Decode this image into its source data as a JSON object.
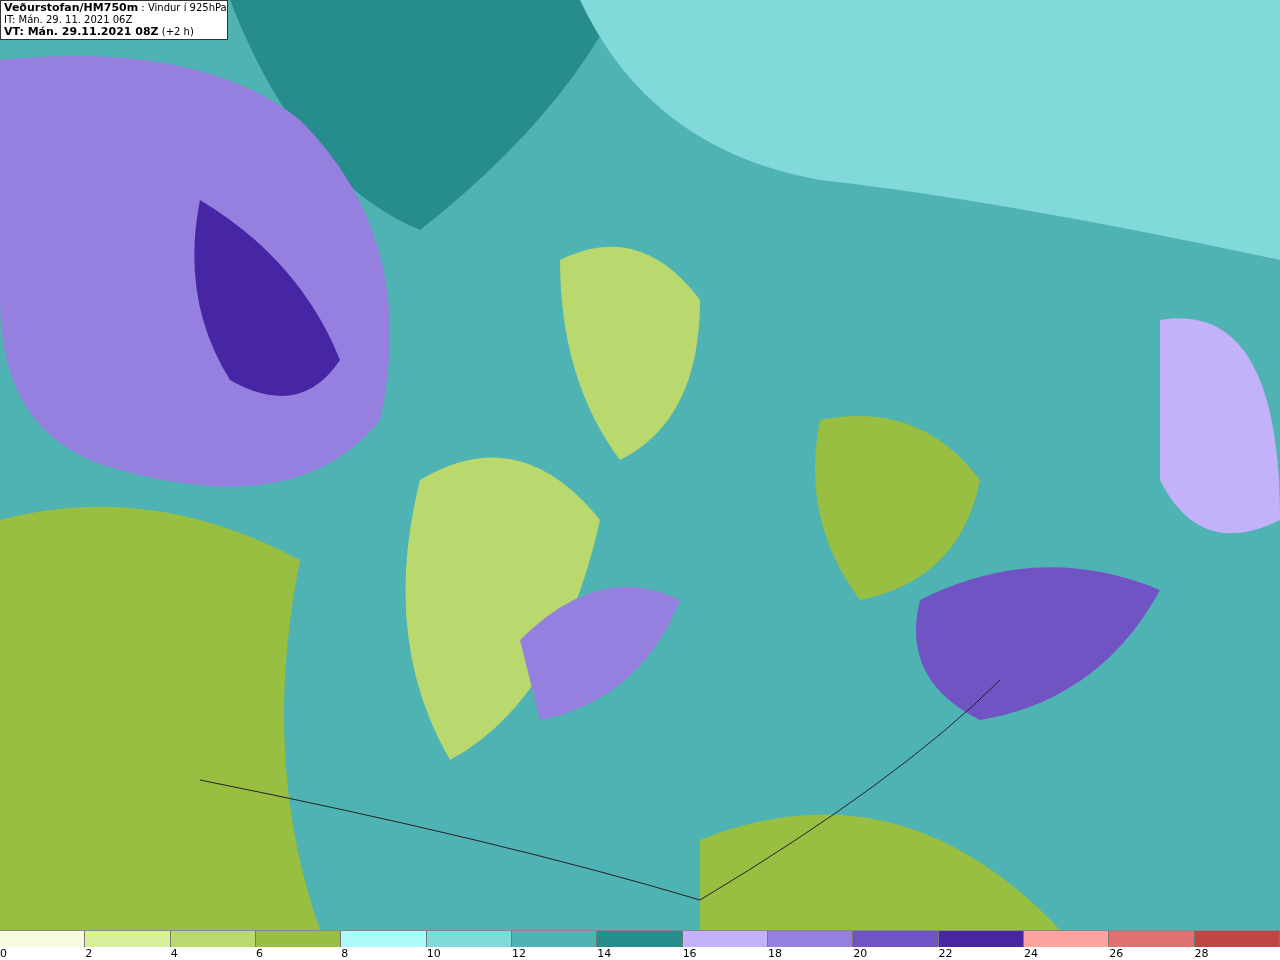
{
  "header": {
    "title": "**Veðurstofan/HM750m** : Vindur í 925hPa",
    "issue_time": "IT: Mán. 29. 11. 2021 06Z",
    "valid_time": "**VT: Mán. 29.11.2021 08Z** (+2 h)"
  },
  "legend": [
    {
      "label": "0",
      "color": "#f5fbdc"
    },
    {
      "label": "2",
      "color": "#d8ef9c"
    },
    {
      "label": "4",
      "color": "#b9d96e"
    },
    {
      "label": "6",
      "color": "#98be42"
    },
    {
      "label": "8",
      "color": "#adfafa"
    },
    {
      "label": "10",
      "color": "#82d9d9"
    },
    {
      "label": "12",
      "color": "#4fb3b3"
    },
    {
      "label": "14",
      "color": "#268c8c"
    },
    {
      "label": "16",
      "color": "#c3b1fa"
    },
    {
      "label": "18",
      "color": "#9580e0"
    },
    {
      "label": "20",
      "color": "#7154c4"
    },
    {
      "label": "22",
      "color": "#4726a6"
    },
    {
      "label": "24",
      "color": "#fda1a1"
    },
    {
      "label": "26",
      "color": "#e07070"
    },
    {
      "label": "28",
      "color": "#c24545"
    }
  ]
}
